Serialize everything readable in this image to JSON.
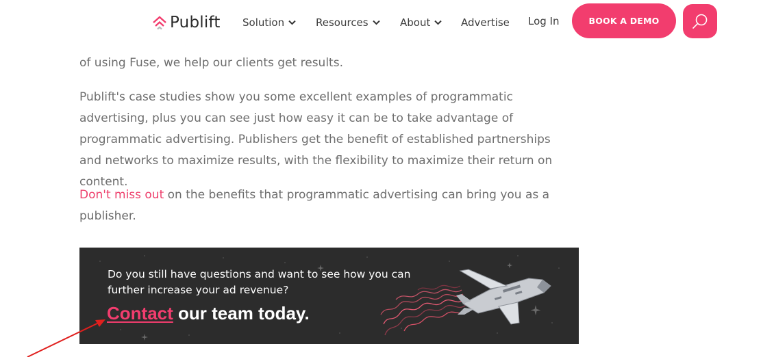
{
  "header": {
    "logo_text": "Publift",
    "nav": [
      {
        "label": "Solution",
        "has_dropdown": true
      },
      {
        "label": "Resources",
        "has_dropdown": true
      },
      {
        "label": "About",
        "has_dropdown": true
      },
      {
        "label": "Advertise",
        "has_dropdown": false
      },
      {
        "label": "Log In",
        "has_dropdown": false
      }
    ],
    "cta_label": "BOOK A DEMO",
    "search_icon": "search-icon"
  },
  "content": {
    "para1": "of using Fuse, we help our clients get results.",
    "para2": "Publift's case studies show you some excellent examples of programmatic advertising, plus you can see just how easy it can be to take advantage of programmatic advertising. Publishers get the benefit of established partnerships and networks to maximize results, with the flexibility to maximize their return on content.",
    "para3_link": "Don't miss out",
    "para3_rest": " on the benefits that programmatic advertising can bring you as a publisher."
  },
  "banner": {
    "question": "Do you still have questions and want to see how you can further increase your ad revenue?",
    "cta_link": "Contact",
    "cta_rest": " our team today."
  },
  "colors": {
    "brand": "#f23d6e",
    "banner_bg": "#2c2c2c",
    "body_text": "#6e6e6e",
    "annotation": "#e0201e"
  }
}
